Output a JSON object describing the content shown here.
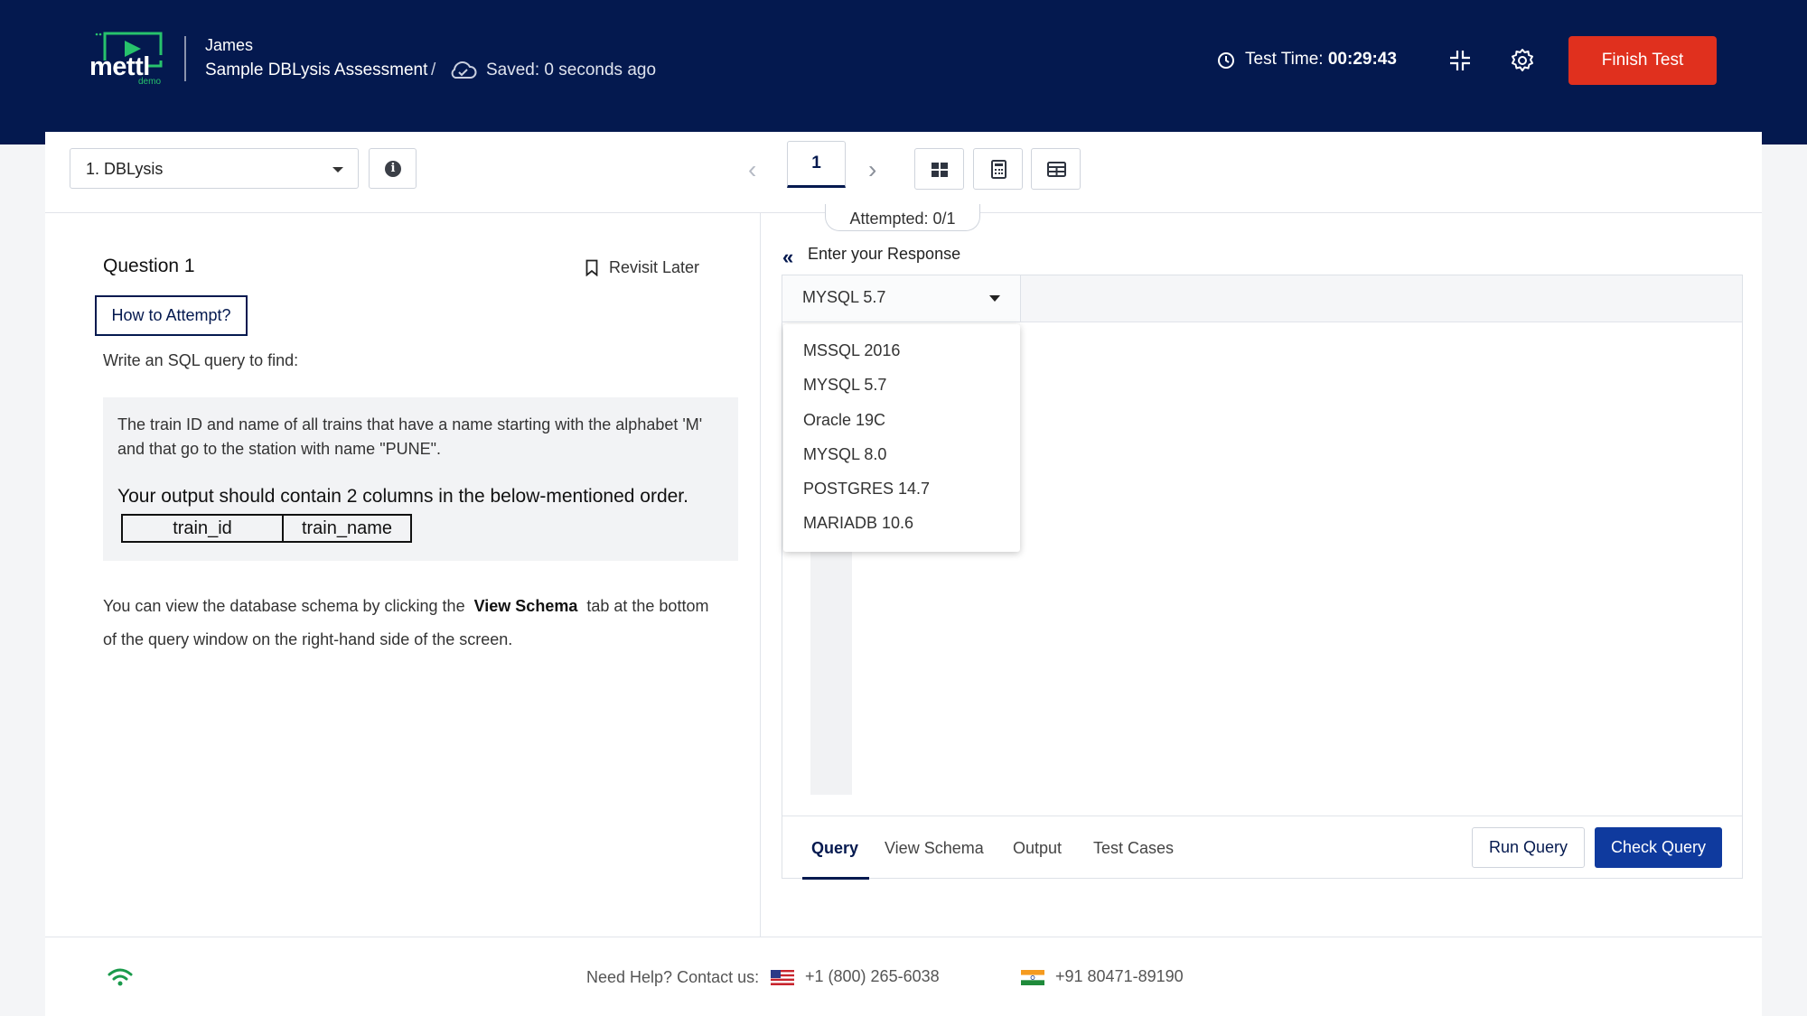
{
  "header": {
    "logo_text": "mettl",
    "logo_sub": "demo",
    "user_name": "James",
    "assessment_name": "Sample DBLysis Assessment",
    "separator": "/",
    "saved_status": "Saved: 0 seconds ago",
    "timer_label": "Test Time:",
    "timer_value": "00:29:43",
    "finish_button": "Finish Test"
  },
  "toolbar": {
    "section_select": "1. DBLysis",
    "info_icon": "i",
    "prev_icon": "‹",
    "next_icon": "›",
    "question_number": "1",
    "attempted": "Attempted: 0/1",
    "icons": [
      "grid-icon",
      "calculator-icon",
      "table-icon"
    ]
  },
  "question": {
    "title": "Question 1",
    "revisit": "Revisit Later",
    "how_to_attempt": "How to Attempt?",
    "intro": "Write an SQL query to find:",
    "text": "The train ID and name of all trains that have a name starting with the alphabet 'M' and that go to the station with name \"PUNE\".",
    "output_note": "Your output should contain 2 columns in the below-mentioned order.",
    "columns": [
      "train_id",
      "train_name"
    ],
    "schema_note_1": "You can view the database schema by clicking the",
    "schema_note_bold": "View Schema",
    "schema_note_2": "tab at the bottom of the query window on the right-hand side of the screen."
  },
  "response": {
    "back_icon": "«",
    "heading": "Enter your Response",
    "selected_language": "MYSQL 5.7",
    "language_options": [
      "MSSQL 2016",
      "MYSQL 5.7",
      "Oracle 19C",
      "MYSQL 8.0",
      "POSTGRES 14.7",
      "MARIADB 10.6"
    ],
    "tabs": [
      "Query",
      "View Schema",
      "Output",
      "Test Cases"
    ],
    "run_button": "Run Query",
    "check_button": "Check Query"
  },
  "footer": {
    "help": "Need Help? Contact us:",
    "us_phone": "+1 (800) 265-6038",
    "in_phone": "+91 80471-89190"
  },
  "colors": {
    "header_bg": "#04194f",
    "finish_button": "#e0301e",
    "primary_button": "#0f3a9e",
    "logo_accent": "#27c26c"
  }
}
